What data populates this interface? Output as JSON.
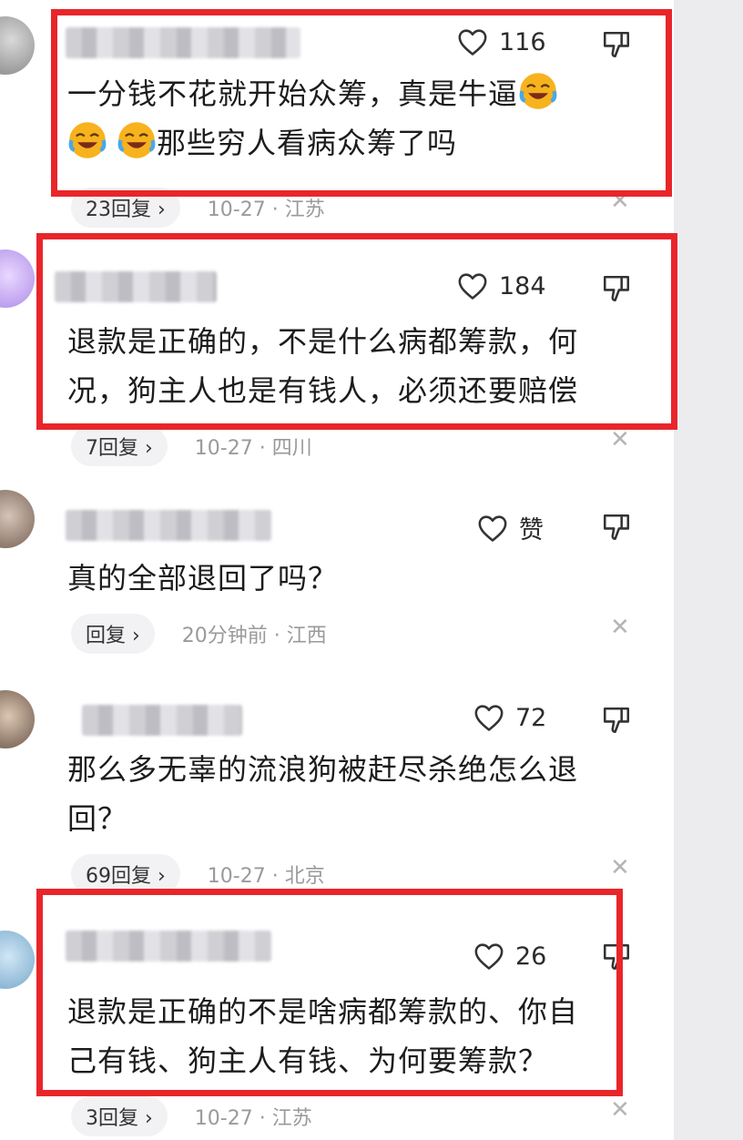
{
  "comments": [
    {
      "likes": "116",
      "lines": [
        "一分钱不花就开始众筹，真是牛逼",
        "那些穷人看病众筹了吗"
      ],
      "reply": "23回复 ›",
      "meta": "10-27 · 江苏"
    },
    {
      "likes": "184",
      "lines": [
        "退款是正确的，不是什么病都筹款，何",
        "况，狗主人也是有钱人，必须还要赔偿"
      ],
      "reply": "7回复 ›",
      "meta": "10-27 · 四川"
    },
    {
      "likes": "赞",
      "lines": [
        "真的全部退回了吗？"
      ],
      "reply": "回复 ›",
      "meta": "20分钟前 · 江西"
    },
    {
      "likes": "72",
      "lines": [
        "那么多无辜的流浪狗被赶尽杀绝怎么退",
        "回？"
      ],
      "reply": "69回复 ›",
      "meta": "10-27 · 北京"
    },
    {
      "likes": "26",
      "lines": [
        "退款是正确的不是啥病都筹款的、你自",
        "己有钱、狗主人有钱、为何要筹款？"
      ],
      "reply": "3回复 ›",
      "meta": "10-27 · 江苏"
    }
  ],
  "icons": {
    "like": "heart-icon",
    "dislike": "dislike-icon",
    "close": "close-icon",
    "emoji": "laughing-crying-emoji"
  },
  "colors": {
    "highlight": "#e8262a",
    "emoji_face": "#f7b21e"
  }
}
